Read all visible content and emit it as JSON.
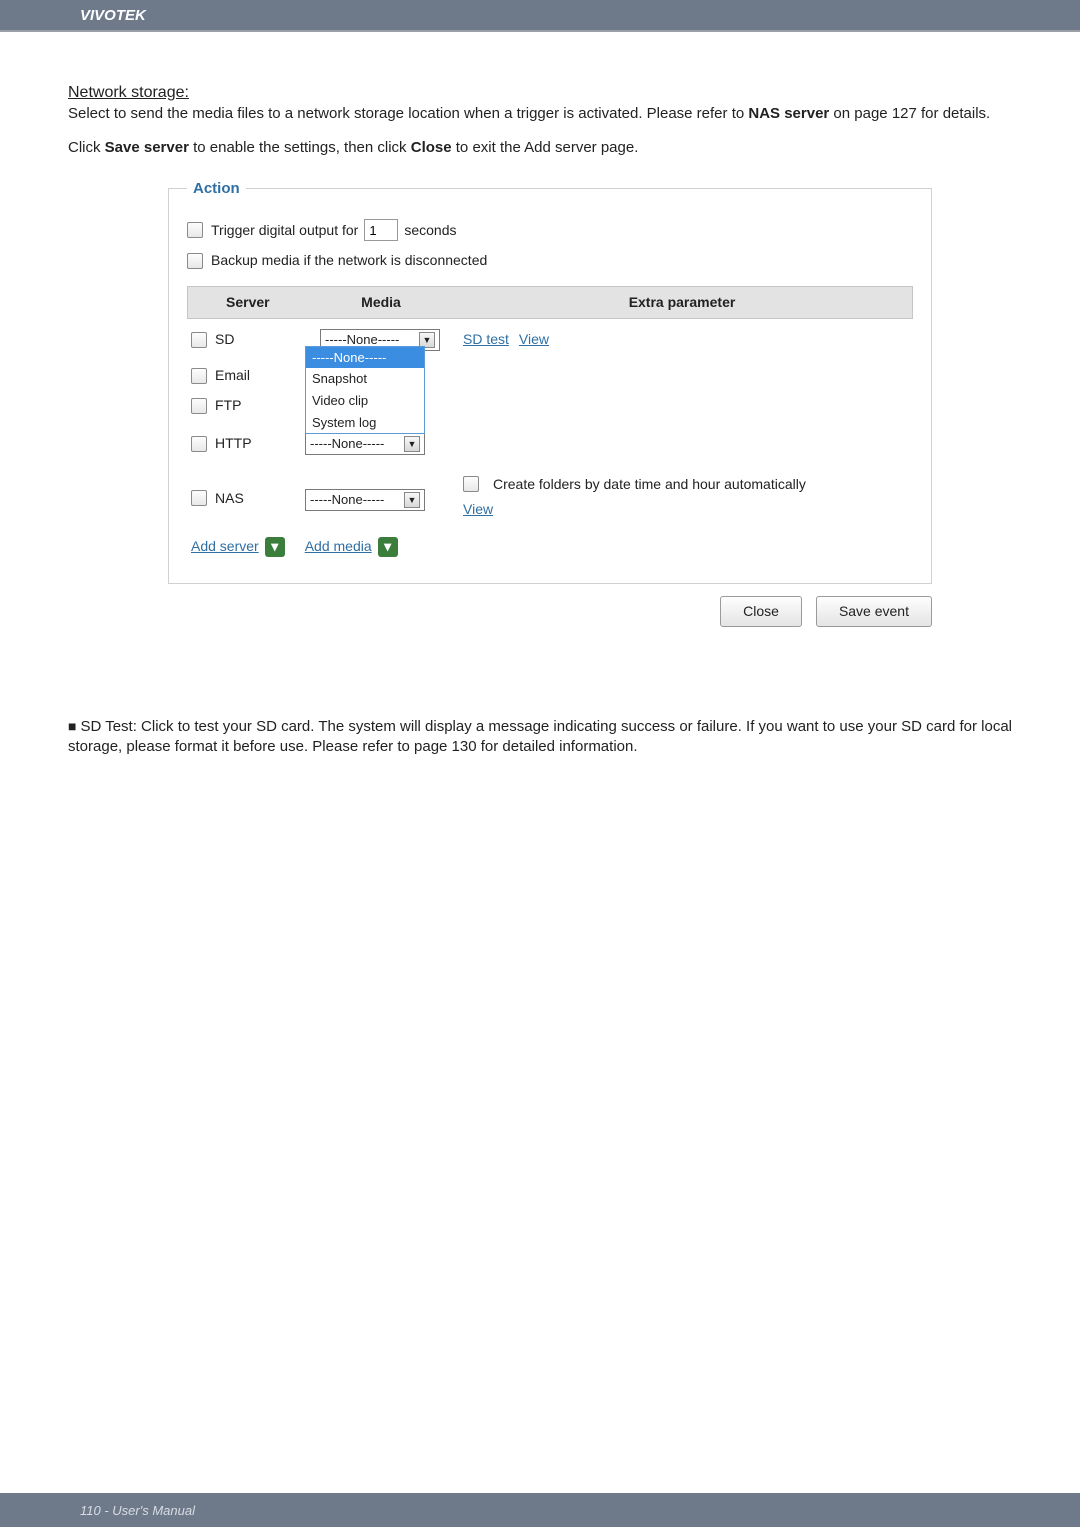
{
  "brand": "VIVOTEK",
  "section": {
    "title": "Network storage:",
    "p1a": "Select to send the media files to a network storage location when a trigger is activated. Please refer to ",
    "p1b": "NAS server",
    "p1c": " on page 127 for details.",
    "p2a": "Click ",
    "p2b": "Save server",
    "p2c": " to enable the settings, then click ",
    "p2d": "Close",
    "p2e": " to exit the Add server page."
  },
  "action": {
    "legend": "Action",
    "trigger_label_a": "Trigger digital output for",
    "trigger_value": "1",
    "trigger_label_b": "seconds",
    "backup_label": "Backup media if the network is disconnected",
    "headers": {
      "server": "Server",
      "media": "Media",
      "extra": "Extra parameter"
    },
    "rows": {
      "sd": {
        "name": "SD",
        "media": "-----None-----",
        "sd_test": "SD test",
        "view": "View",
        "options": [
          "-----None-----",
          "Snapshot",
          "Video clip",
          "System log"
        ]
      },
      "email": {
        "name": "Email"
      },
      "ftp": {
        "name": "FTP"
      },
      "http": {
        "name": "HTTP",
        "media": "-----None-----"
      },
      "nas": {
        "name": "NAS",
        "media": "-----None-----",
        "create_folders": "Create folders by date time and hour automatically",
        "view": "View"
      }
    },
    "add_server": "Add server",
    "add_media": "Add media",
    "close": "Close",
    "save_event": "Save event"
  },
  "sd_test_note": {
    "bullet": "■",
    "text": "SD Test: Click to test your SD card. The system will display a message indicating success or failure. If you want to use your SD card for local storage, please format it before use. Please refer to page 130 for detailed information."
  },
  "footer": "110 - User's Manual"
}
